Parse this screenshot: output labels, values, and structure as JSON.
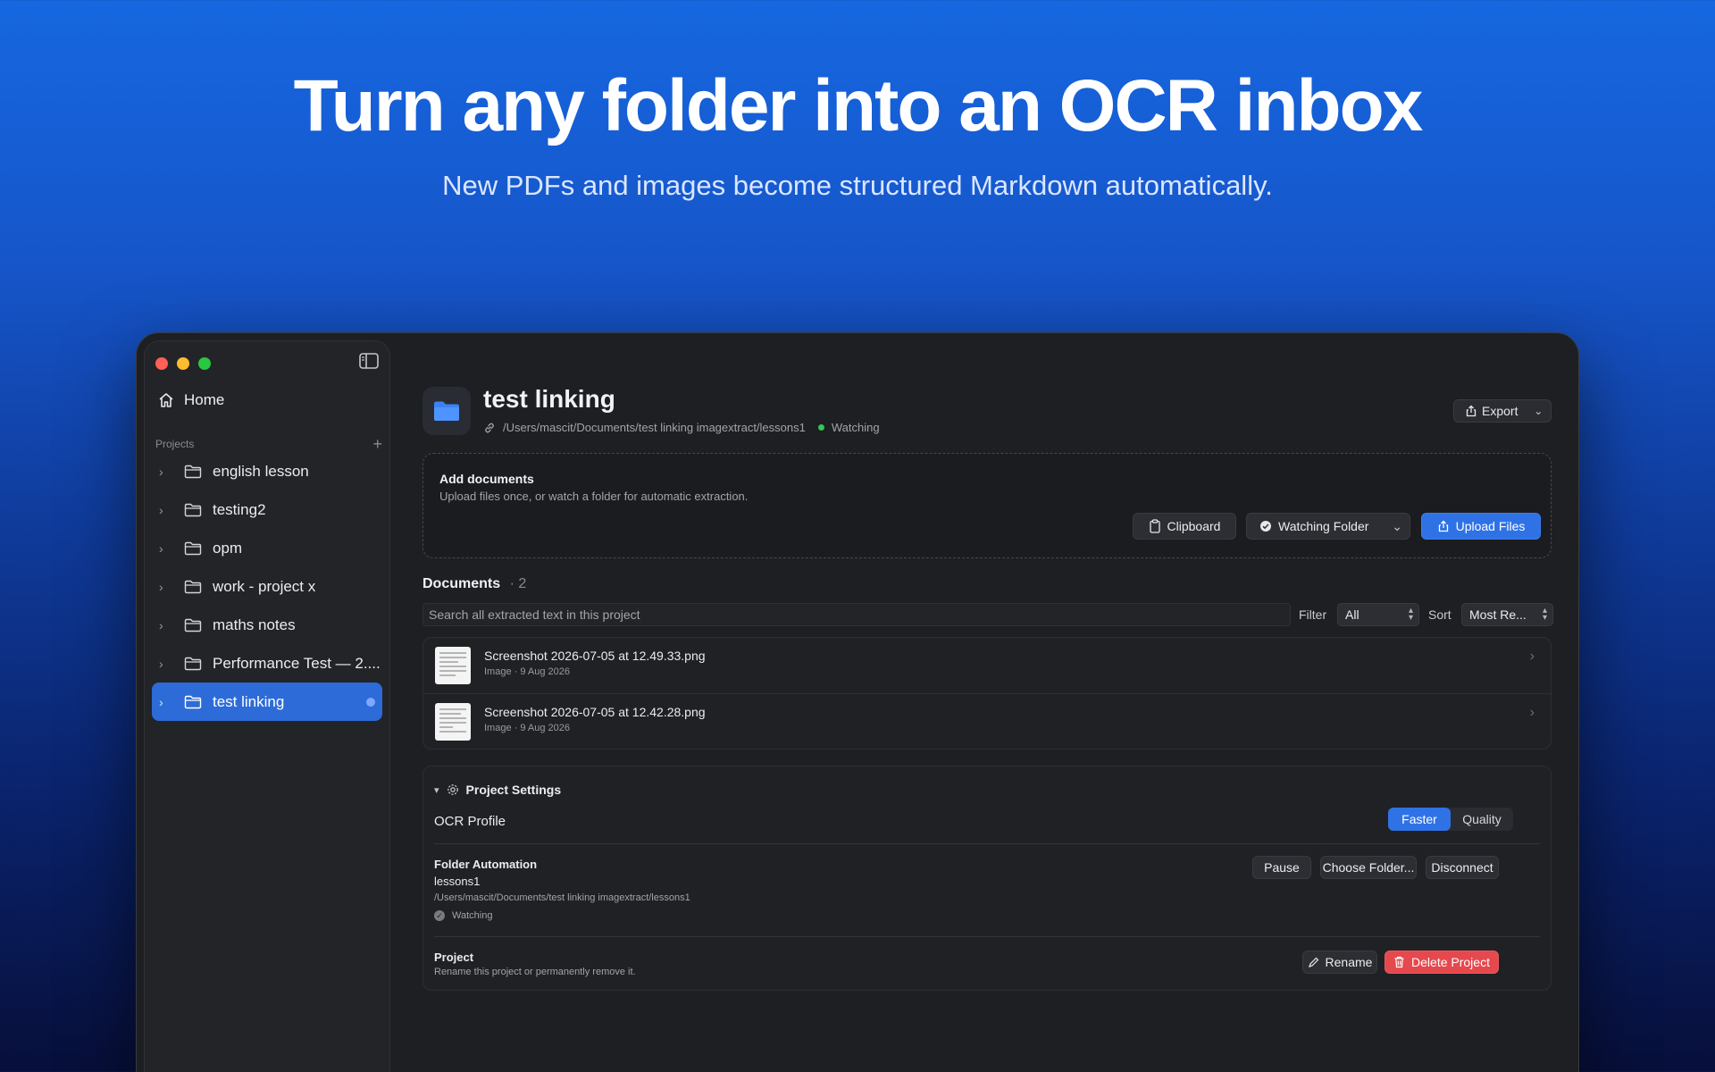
{
  "hero": {
    "title": "Turn any folder into an OCR inbox",
    "subtitle": "New PDFs and images become structured Markdown automatically."
  },
  "sidebar": {
    "home_label": "Home",
    "projects_label": "Projects",
    "projects": [
      {
        "label": "english lesson",
        "active": false
      },
      {
        "label": "testing2",
        "active": false
      },
      {
        "label": "opm",
        "active": false
      },
      {
        "label": "work - project x",
        "active": false
      },
      {
        "label": "maths notes",
        "active": false
      },
      {
        "label": "Performance Test — 2....",
        "active": false
      },
      {
        "label": "test linking",
        "active": true
      }
    ]
  },
  "project": {
    "title": "test linking",
    "path": "/Users/mascit/Documents/test linking imagextract/lessons1",
    "status": "Watching",
    "export_label": "Export"
  },
  "add_documents": {
    "title": "Add documents",
    "subtitle": "Upload files once, or watch a folder for automatic extraction.",
    "clipboard_label": "Clipboard",
    "watching_label": "Watching Folder",
    "upload_label": "Upload Files"
  },
  "documents": {
    "title": "Documents",
    "count": "2",
    "search_placeholder": "Search all extracted text in this project",
    "filter_label": "Filter",
    "filter_value": "All",
    "sort_label": "Sort",
    "sort_value": "Most Re...",
    "items": [
      {
        "name": "Screenshot 2026-07-05 at 12.49.33.png",
        "meta": "Image · 9 Aug 2026"
      },
      {
        "name": "Screenshot 2026-07-05 at 12.42.28.png",
        "meta": "Image · 9 Aug 2026"
      }
    ]
  },
  "settings": {
    "title": "Project Settings",
    "ocr_profile_label": "OCR Profile",
    "ocr_options": [
      "Faster",
      "Quality"
    ],
    "ocr_selected": "Faster",
    "folder_automation": {
      "title": "Folder Automation",
      "folder_name": "lessons1",
      "folder_path": "/Users/mascit/Documents/test linking imagextract/lessons1",
      "status": "Watching",
      "pause_label": "Pause",
      "choose_label": "Choose Folder...",
      "disconnect_label": "Disconnect"
    },
    "project_section": {
      "title": "Project",
      "subtitle": "Rename this project or permanently remove it.",
      "rename_label": "Rename",
      "delete_label": "Delete Project"
    }
  },
  "colors": {
    "accent": "#2f72e6",
    "danger": "#e5484d",
    "watching": "#33c65a"
  }
}
